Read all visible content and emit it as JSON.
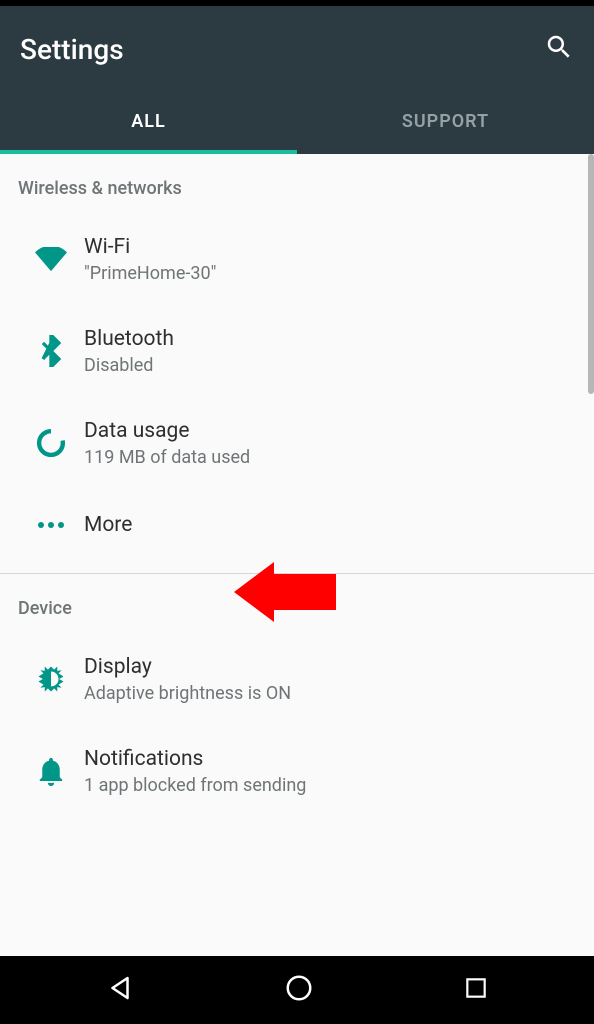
{
  "header": {
    "title": "Settings"
  },
  "tabs": {
    "all": "ALL",
    "support": "SUPPORT"
  },
  "sections": {
    "wireless": "Wireless & networks",
    "device": "Device"
  },
  "items": {
    "wifi": {
      "title": "Wi-Fi",
      "sub": "\"PrimeHome-30\""
    },
    "bluetooth": {
      "title": "Bluetooth",
      "sub": "Disabled"
    },
    "data": {
      "title": "Data usage",
      "sub": "119 MB of data used"
    },
    "more": {
      "title": "More"
    },
    "display": {
      "title": "Display",
      "sub": "Adaptive brightness is ON"
    },
    "notifications": {
      "title": "Notifications",
      "sub": "1 app blocked from sending"
    }
  },
  "colors": {
    "accent": "#009688",
    "appbar": "#2b3b41",
    "tabIndicator": "#1abc9c",
    "background": "#fafafa",
    "arrow": "#ff0000"
  }
}
